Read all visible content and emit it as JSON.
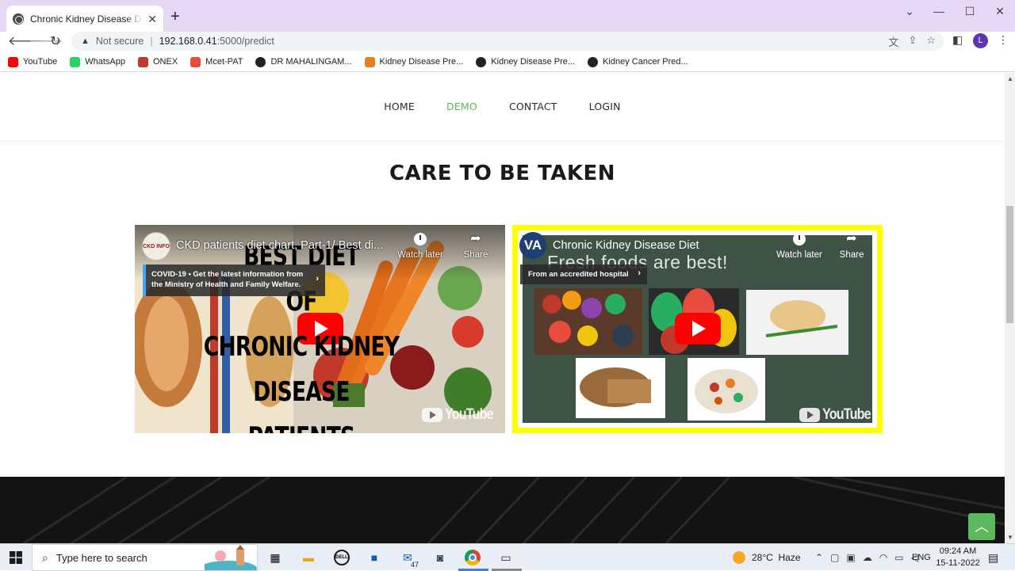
{
  "browser": {
    "tab_title": "Chronic Kidney Disease Detection",
    "tab_close": "✕",
    "new_tab": "+",
    "address": {
      "security_label": "Not secure",
      "host": "192.168.0.41",
      "path": ":5000/predict"
    },
    "profile_initial": "L",
    "bookmarks": [
      {
        "label": "YouTube",
        "icon": "youtube-icon",
        "color": "#ff0000"
      },
      {
        "label": "WhatsApp",
        "icon": "whatsapp-icon",
        "color": "#25d366"
      },
      {
        "label": "ONEX",
        "icon": "onex-icon",
        "color": "#c0392b"
      },
      {
        "label": "Mcet-PAT",
        "icon": "mcet-icon",
        "color": "#e74c3c"
      },
      {
        "label": "DR MAHALINGAM...",
        "icon": "globe-icon",
        "color": "#202124"
      },
      {
        "label": "Kidney Disease Pre...",
        "icon": "kidney-icon",
        "color": "#e67e22"
      },
      {
        "label": "Kidney Disease Pre...",
        "icon": "globe-icon",
        "color": "#202124"
      },
      {
        "label": "Kidney Cancer Pred...",
        "icon": "globe-icon",
        "color": "#202124"
      }
    ]
  },
  "site": {
    "nav": [
      {
        "label": "HOME",
        "active": false
      },
      {
        "label": "DEMO",
        "active": true
      },
      {
        "label": "CONTACT",
        "active": false
      },
      {
        "label": "LOGIN",
        "active": false
      }
    ],
    "accent_color": "#5cb85c",
    "section_title": "CARE TO BE TAKEN",
    "videos": [
      {
        "title": "CKD patients diet chart, Part-1/ Best di...",
        "channel_badge": "CKD INFO",
        "notice_line1": "COVID-19 • Get the latest information from",
        "notice_line2": "the Ministry of Health and Family Welfare.",
        "overlay_lines": [
          "BEST DIET",
          "OF",
          "CHRONIC KIDNEY DISEASE",
          "PATIENTS"
        ],
        "watch_later": "Watch later",
        "share": "Share",
        "brand": "YouTube"
      },
      {
        "title": "Chronic Kidney Disease Diet",
        "channel_badge": "VA",
        "notice": "From an accredited hospital",
        "headline": "Fresh foods are best!",
        "watch_later": "Watch later",
        "share": "Share",
        "brand": "YouTube"
      }
    ]
  },
  "taskbar": {
    "search_placeholder": "Type here to search",
    "mail_badge": "47",
    "weather": "28°C  Haze",
    "language": "ENG",
    "time": "09:24 AM",
    "date": "15-11-2022"
  }
}
